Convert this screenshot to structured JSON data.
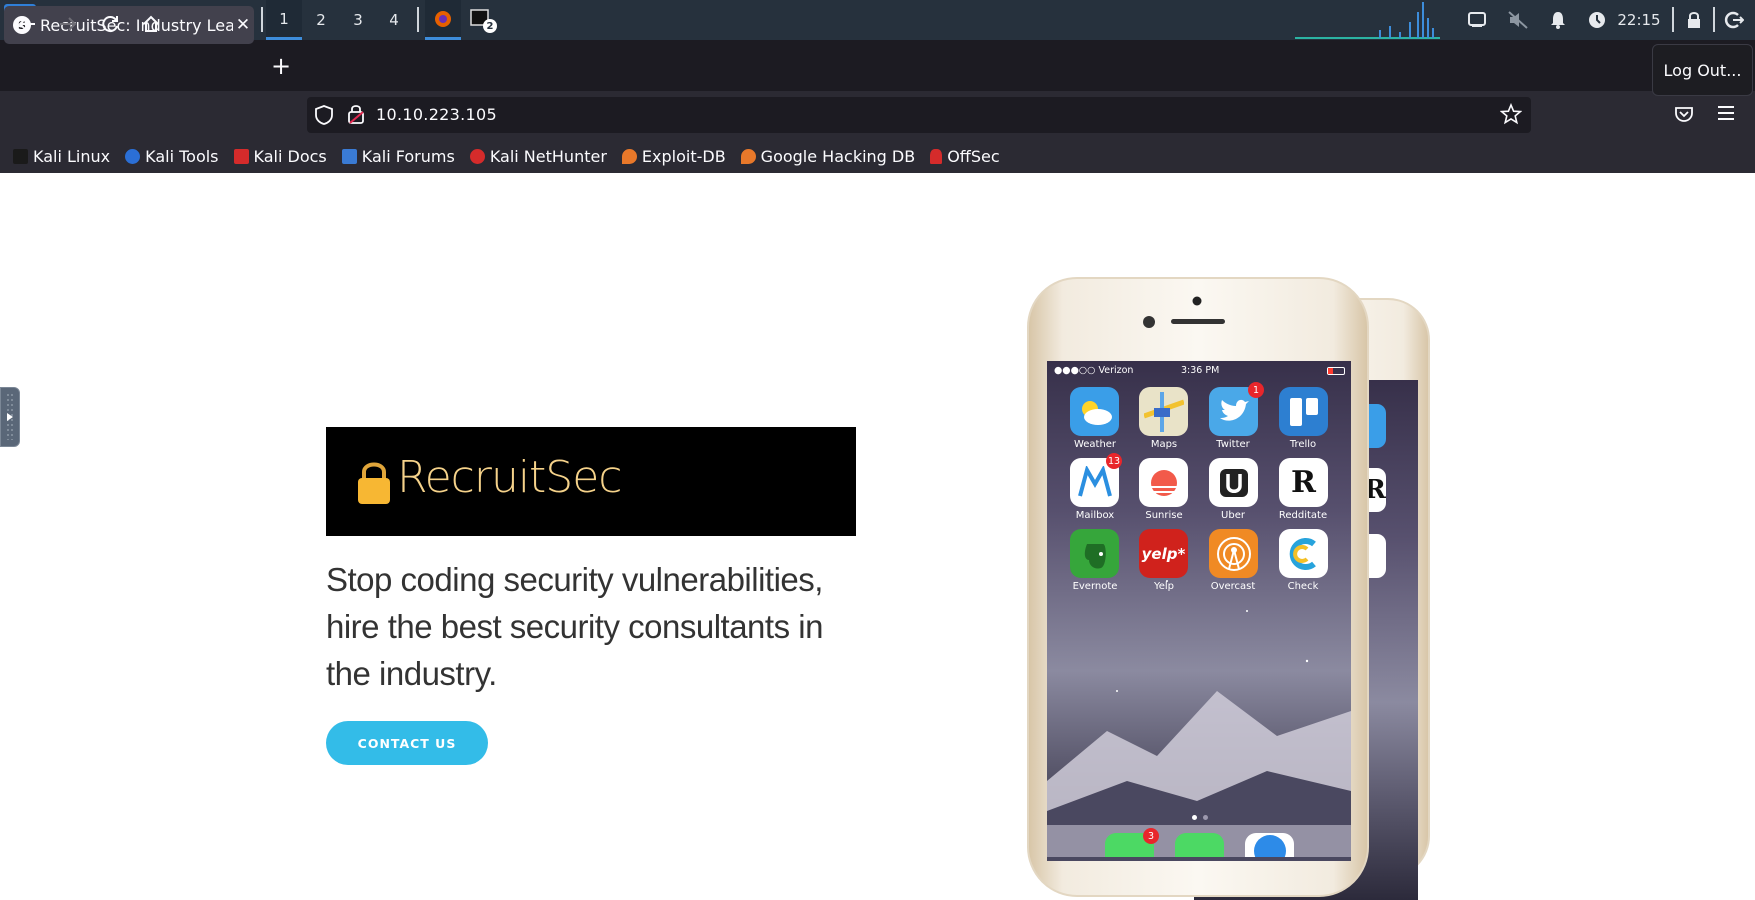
{
  "taskbar": {
    "workspaces": [
      "1",
      "2",
      "3",
      "4"
    ],
    "active_workspace_index": 0,
    "terminal_badge": "2",
    "clock": "22:15",
    "icons": [
      "kali-menu-icon",
      "show-desktop-icon",
      "file-manager-icon",
      "text-editor-icon",
      "firefox-icon",
      "terminal-icon",
      "chevron-down-icon",
      "network-monitor-graph",
      "display-icon",
      "muted-speaker-icon",
      "bell-icon",
      "power-manager-icon",
      "lock-icon",
      "logout-icon"
    ]
  },
  "browser": {
    "tab": {
      "title": "RecruitSec: Industry Leading",
      "favicon_letter": "S"
    },
    "new_tab_label": "+",
    "url": "10.10.223.105",
    "tooltip": "Log Out...",
    "bookmarks": [
      {
        "label": "Kali Linux",
        "icon": "kali-dragon-icon",
        "color": "#1a1a1a"
      },
      {
        "label": "Kali Tools",
        "icon": "kali-tools-icon",
        "color": "#2b6fd6"
      },
      {
        "label": "Kali Docs",
        "icon": "kali-docs-icon",
        "color": "#d52b2b"
      },
      {
        "label": "Kali Forums",
        "icon": "kali-forums-icon",
        "color": "#3a7bd5"
      },
      {
        "label": "Kali NetHunter",
        "icon": "nethunter-icon",
        "color": "#d52b2b"
      },
      {
        "label": "Exploit-DB",
        "icon": "exploit-db-icon",
        "color": "#e8782a"
      },
      {
        "label": "Google Hacking DB",
        "icon": "ghdb-icon",
        "color": "#e8782a"
      },
      {
        "label": "OffSec",
        "icon": "offsec-icon",
        "color": "#d52b2b"
      }
    ]
  },
  "page": {
    "logo_text": "RecruitSec",
    "hero_text": "Stop coding security vulnerabilities, hire the best security consultants in the industry.",
    "contact_button": "CONTACT US",
    "phone": {
      "carrier": "●●●○○ Verizon",
      "time": "3:36 PM",
      "apps": [
        {
          "label": "Weather",
          "color": "#3a9ee8",
          "badge": ""
        },
        {
          "label": "Maps",
          "color": "#e9e3c8",
          "badge": ""
        },
        {
          "label": "Twitter",
          "color": "#4aa8e8",
          "badge": "1"
        },
        {
          "label": "Trello",
          "color": "#2d7fd1",
          "badge": ""
        },
        {
          "label": "Mailbox",
          "color": "#ffffff",
          "badge": "13"
        },
        {
          "label": "Sunrise",
          "color": "#ffffff",
          "badge": ""
        },
        {
          "label": "Uber",
          "color": "#ffffff",
          "badge": ""
        },
        {
          "label": "Redditate",
          "color": "#ffffff",
          "badge": ""
        },
        {
          "label": "Evernote",
          "color": "#36a63b",
          "badge": ""
        },
        {
          "label": "Yelp",
          "color": "#d0221c",
          "badge": ""
        },
        {
          "label": "Overcast",
          "color": "#f08a24",
          "badge": ""
        },
        {
          "label": "Check",
          "color": "#ffffff",
          "badge": ""
        }
      ],
      "dock_badge": "3"
    }
  }
}
